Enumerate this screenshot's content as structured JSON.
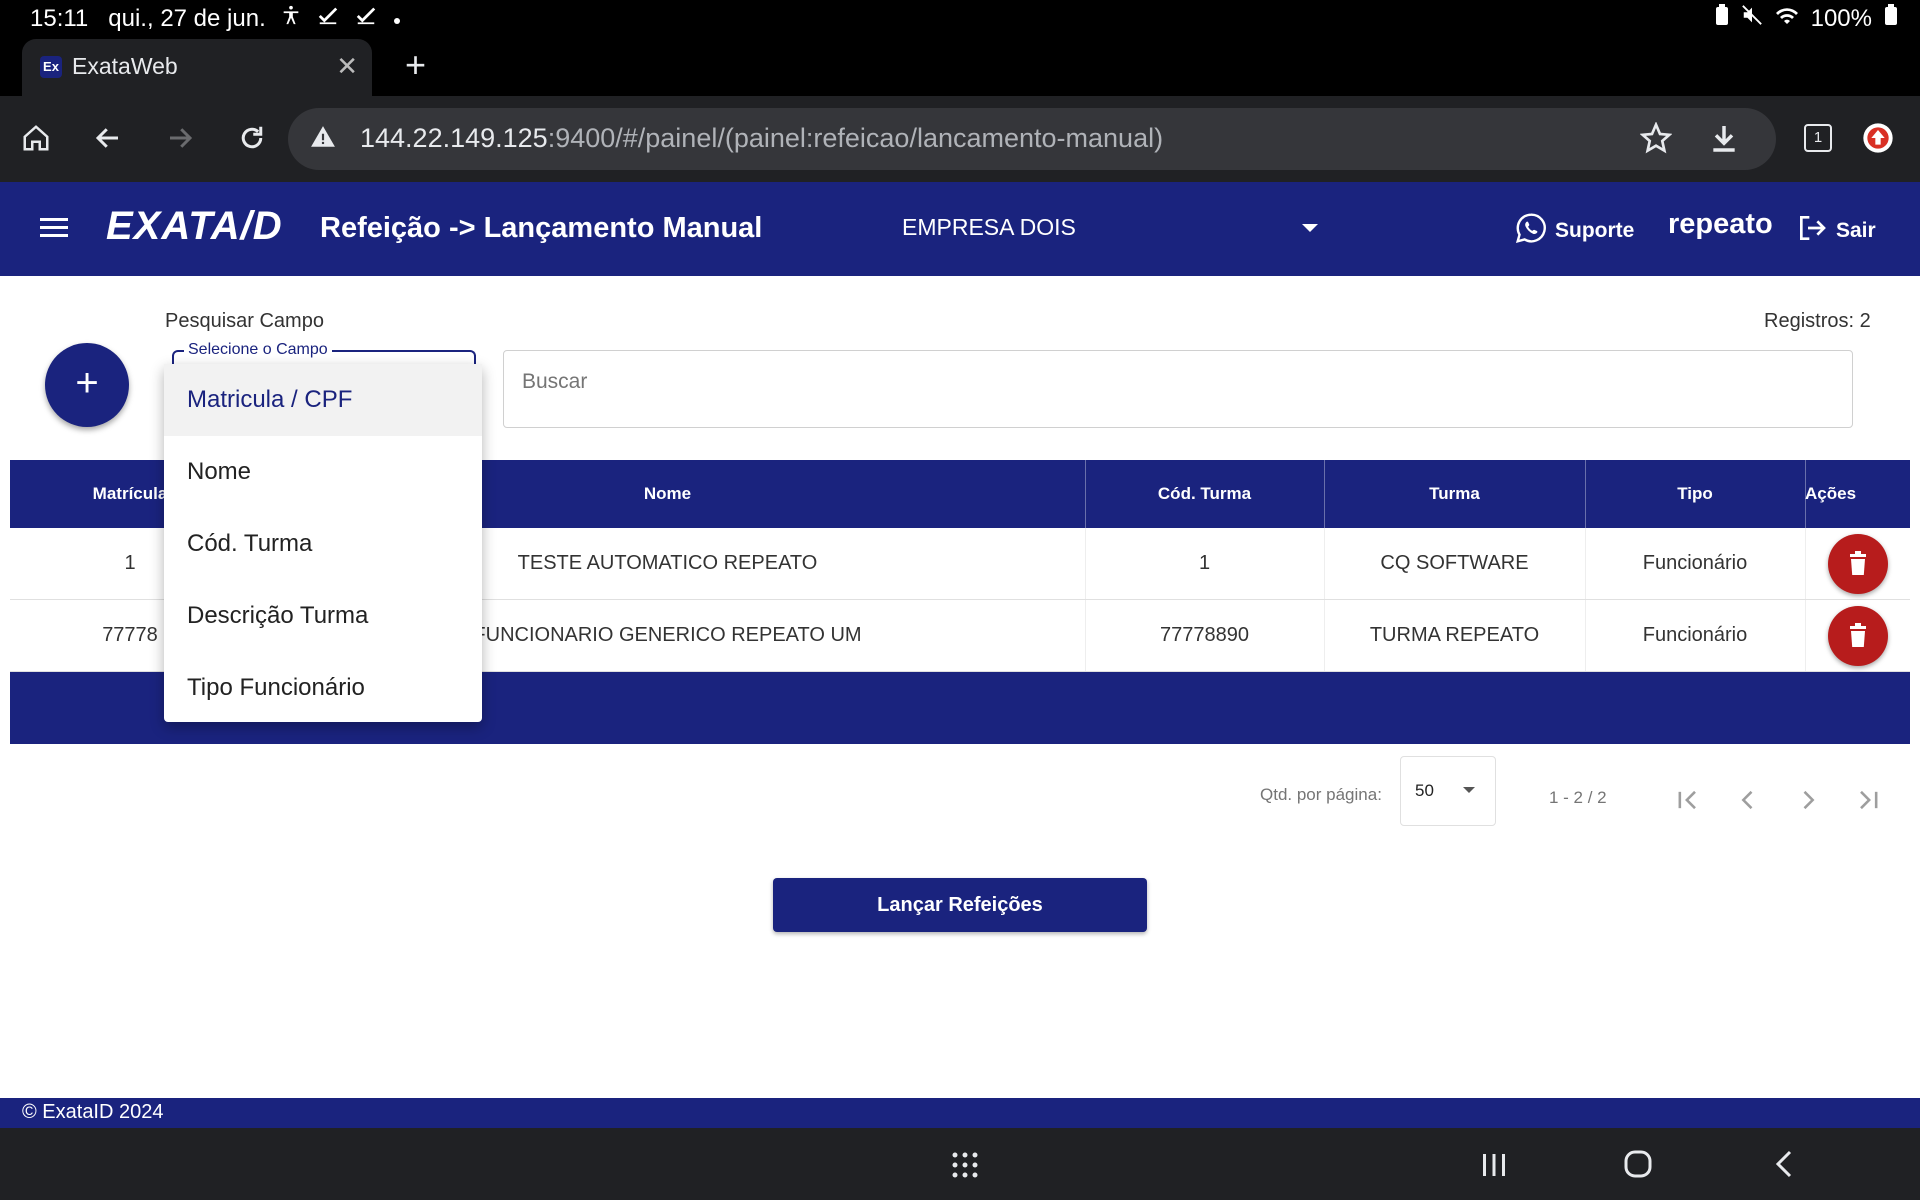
{
  "status_bar": {
    "time": "15:11",
    "date": "qui., 27 de jun.",
    "battery": "100%"
  },
  "browser": {
    "tab_title": "ExataWeb",
    "tab_favicon": "Ex",
    "url_host": "144.22.149.125",
    "url_rest": ":9400/#/painel/(painel:refeicao/lancamento-manual)",
    "tab_count": "1"
  },
  "header": {
    "logo": "EXATA/D",
    "page_title": "Refeição -> Lançamento Manual",
    "company": "EMPRESA DOIS",
    "support_label": "Suporte",
    "username": "repeato",
    "logout_label": "Sair"
  },
  "search": {
    "field_label": "Pesquisar Campo",
    "select_label": "Selecione o Campo",
    "placeholder": "Buscar",
    "records": "Registros: 2"
  },
  "table": {
    "columns": [
      "Matrícula",
      "Nome",
      "Cód. Turma",
      "Turma",
      "Tipo",
      "Ações"
    ],
    "rows": [
      {
        "matricula": "1",
        "nome": "TESTE AUTOMATICO REPEATO",
        "cod_turma": "1",
        "turma": "CQ SOFTWARE",
        "tipo": "Funcionário"
      },
      {
        "matricula": "77778",
        "nome": "FUNCIONARIO GENERICO REPEATO UM",
        "cod_turma": "77778890",
        "turma": "TURMA REPEATO",
        "tipo": "Funcionário"
      }
    ]
  },
  "pager": {
    "label": "Qtd. por página:",
    "page_size": "50",
    "range": "1 - 2 / 2"
  },
  "submit_label": "Lançar Refeições",
  "footer": "© ExataID 2024",
  "dropdown": {
    "options": [
      "Matricula / CPF",
      "Nome",
      "Cód. Turma",
      "Descrição Turma",
      "Tipo Funcionário"
    ],
    "selected": "Matricula / CPF"
  },
  "colors": {
    "primary": "#1a237e",
    "danger": "#b71c1c"
  }
}
